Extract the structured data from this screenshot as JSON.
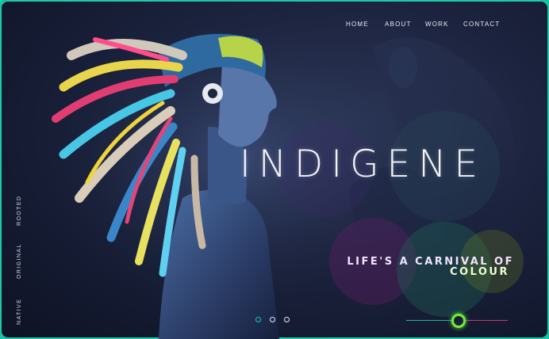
{
  "nav": {
    "items": [
      {
        "label": "HOME"
      },
      {
        "label": "ABOUT"
      },
      {
        "label": "WORK"
      },
      {
        "label": "CONTACT"
      }
    ]
  },
  "hero": {
    "title": "INDIGENE",
    "tagline_line1": "LIFE'S A CARNIVAL OF",
    "tagline_line2": "COLOUR"
  },
  "side_words": [
    "NATIVE",
    "ORIGINAL",
    "ROOTED"
  ],
  "carousel": {
    "slide_count": 3,
    "active_index": 0
  },
  "slider": {
    "value": 0.5
  },
  "colors": {
    "frame_border": "#1ccaa8",
    "background": "#141a30",
    "dot_active": "#15c7b0",
    "slider_left": "#19b89b",
    "slider_right": "#c63c6d",
    "slider_handle": "#6cf03a"
  }
}
